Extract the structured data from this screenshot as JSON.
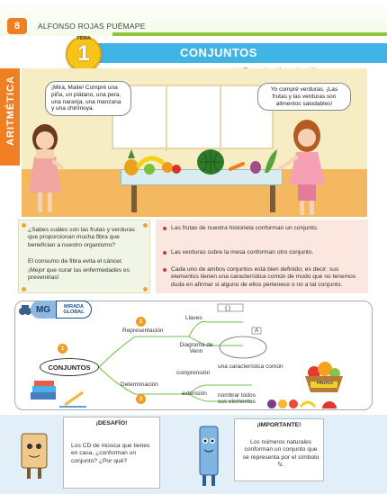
{
  "header": {
    "page_number": "8",
    "author": "ALFONSO ROJAS PUÉMAPE",
    "tema_label": "TEMA",
    "tema_number": "1",
    "title": "CONJUNTOS",
    "subtitle": "Comunicación matemática",
    "side_tab": "ARITMÉTICA"
  },
  "comic": {
    "bubble_left": "¡Mira, Maite! Compré una piña, un plátano, una pera, una naranja, una manzana y una chirimoya.",
    "bubble_right": "Yo compré verduras. ¡Las frutas y las verduras son alimentos saludables!"
  },
  "question_box": {
    "p1": "¿Sabes cuáles son las frutas y verduras que proporcionan mucha fibra que benefician a nuestro organismo?",
    "p2": "El consumo de fibra evita el cáncer.",
    "p3": "¡Mejor que curar las enfermedades es prevenirlas!"
  },
  "notes": [
    "Las frutas de nuestra historieta conforman un conjunto.",
    "Las verduras sobre la mesa conforman otro conjunto.",
    "Cada uno de ambos conjuntos está bien definido; es decir: sus elementos tienen una característica común de modo que no tenemos duda en afirmar si alguno de ellos pertenece o no a tal conjunto."
  ],
  "concept_map": {
    "badge": "MG",
    "badge_text": "MIRADA GLOBAL",
    "center": "CONJUNTOS",
    "num1": "1",
    "num2": "2",
    "num3": "3",
    "representacion": "Representación",
    "llaves": "Llaves",
    "llaves_symbol": "{ }",
    "diagrama": "Diagrama de Venn",
    "venn_label": "A",
    "determinacion": "Determinación",
    "comprension": "comprensión",
    "comprension_desc": "una característica común",
    "extension": "extensión",
    "extension_desc": "nombrar todos sus elementos",
    "frutas_label": "FRUTAS"
  },
  "desafio": {
    "title": "¡DESAFÍO!",
    "text": "Los CD de música que tienes en casa, ¿conforman un conjunto? ¿Por qué?"
  },
  "importante": {
    "title": "¡IMPORTANTE!",
    "text": "Los números naturales conforman un conjunto que se representa por el símbolo ℕ."
  },
  "colors": {
    "orange": "#f07f22",
    "blue": "#3fb4e5",
    "green": "#8cc63f",
    "yellow": "#f7c51a"
  }
}
